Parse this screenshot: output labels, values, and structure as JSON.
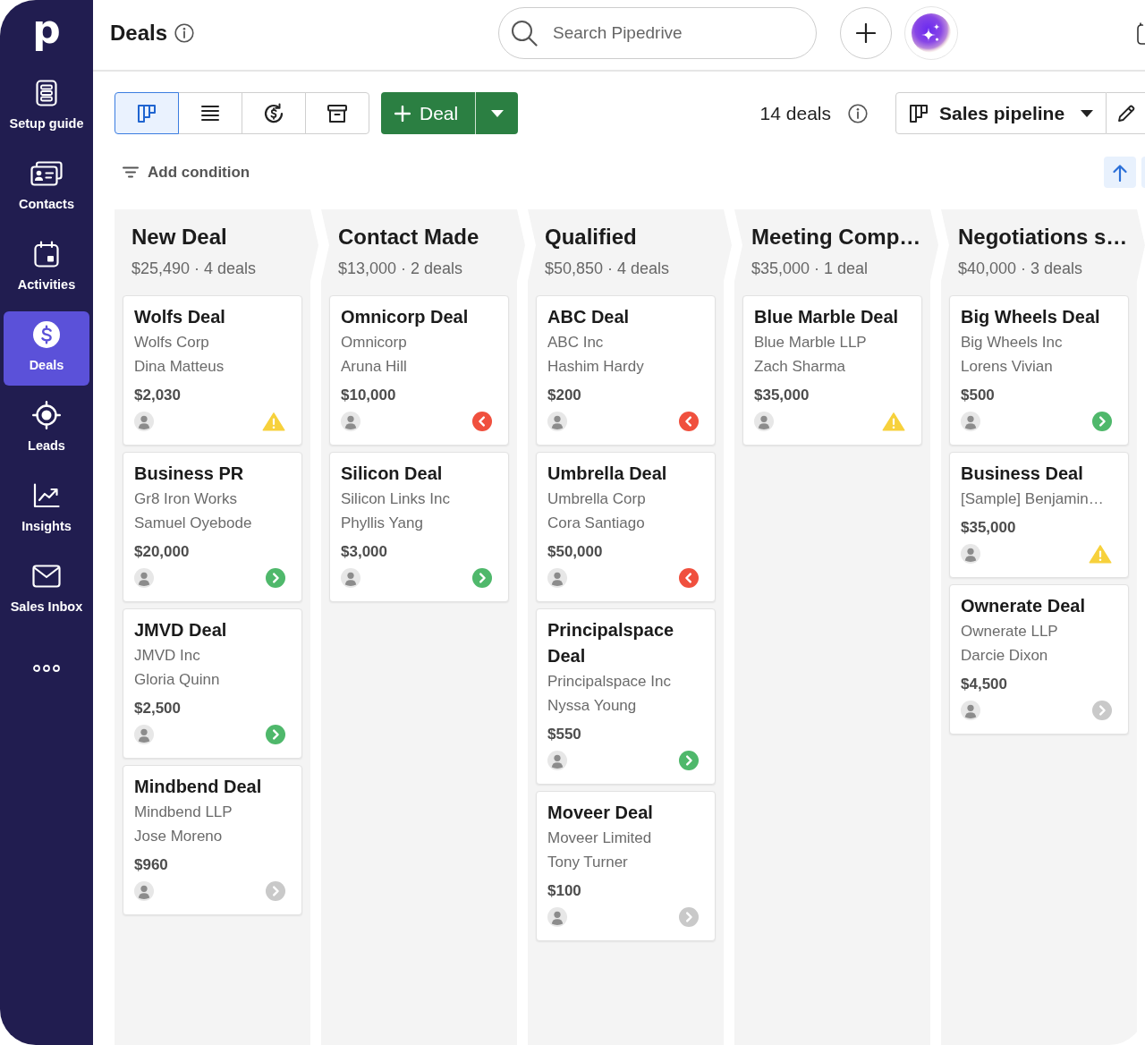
{
  "sidebar": {
    "logo": "p",
    "items": [
      {
        "kind": "guide",
        "label": "Setup guide",
        "selected": false
      },
      {
        "kind": "contacts",
        "label": "Contacts",
        "selected": false
      },
      {
        "kind": "activities",
        "label": "Activities",
        "selected": false
      },
      {
        "kind": "deals",
        "label": "Deals",
        "selected": true
      },
      {
        "kind": "leads",
        "label": "Leads",
        "selected": false
      },
      {
        "kind": "insights",
        "label": "Insights",
        "selected": false
      },
      {
        "kind": "inbox",
        "label": "Sales Inbox",
        "selected": false
      }
    ]
  },
  "header": {
    "title": "Deals",
    "search": {
      "placeholder": "Search Pipedrive"
    }
  },
  "toolbar": {
    "views": [
      {
        "kind": "board",
        "selected": true
      },
      {
        "kind": "list",
        "selected": false
      },
      {
        "kind": "forecast",
        "selected": false
      },
      {
        "kind": "archive",
        "selected": false
      }
    ],
    "add_button": "Deal",
    "deal_count": "14 deals",
    "pipeline": "Sales pipeline",
    "filter": "Add condition"
  },
  "columns": [
    {
      "title": "New Deal",
      "summary": "$25,490 · 4 deals",
      "deals": [
        {
          "kind": "warning",
          "title": "Wolfs Deal",
          "organization": "Wolfs Corp",
          "person": "Dina Matteus",
          "value": "$2,030"
        },
        {
          "kind": "scheduled",
          "title": "Business PR",
          "organization": "Gr8 Iron Works",
          "person": "Samuel Oyebode",
          "value": "$20,000"
        },
        {
          "kind": "scheduled",
          "title": "JMVD Deal",
          "organization": "JMVD Inc",
          "person": "Gloria Quinn",
          "value": "$2,500"
        },
        {
          "kind": "none",
          "title": "Mindbend Deal",
          "organization": "Mindbend LLP",
          "person": "Jose Moreno",
          "value": "$960"
        }
      ]
    },
    {
      "title": "Contact Made",
      "summary": "$13,000 · 2 deals",
      "deals": [
        {
          "kind": "overdue",
          "title": "Omnicorp Deal",
          "organization": "Omnicorp",
          "person": "Aruna Hill",
          "value": "$10,000"
        },
        {
          "kind": "scheduled",
          "title": "Silicon Deal",
          "organization": "Silicon Links Inc",
          "person": "Phyllis Yang",
          "value": "$3,000"
        }
      ]
    },
    {
      "title": "Qualified",
      "summary": "$50,850 · 4 deals",
      "deals": [
        {
          "kind": "overdue",
          "title": "ABC Deal",
          "organization": "ABC Inc",
          "person": "Hashim Hardy",
          "value": "$200"
        },
        {
          "kind": "overdue",
          "title": "Umbrella Deal",
          "organization": "Umbrella Corp",
          "person": "Cora Santiago",
          "value": "$50,000"
        },
        {
          "kind": "scheduled",
          "title": "Principalspace Deal",
          "organization": "Principalspace Inc",
          "person": "Nyssa Young",
          "value": "$550"
        },
        {
          "kind": "none",
          "title": "Moveer Deal",
          "organization": "Moveer Limited",
          "person": "Tony Turner",
          "value": "$100"
        }
      ]
    },
    {
      "title": "Meeting Comp…",
      "summary": "$35,000 · 1 deal",
      "deals": [
        {
          "kind": "warning",
          "title": "Blue Marble Deal",
          "organization": "Blue Marble LLP",
          "person": "Zach Sharma",
          "value": "$35,000"
        }
      ]
    },
    {
      "title": "Negotiations s…",
      "summary": "$40,000 · 3 deals",
      "deals": [
        {
          "kind": "scheduled",
          "title": "Big Wheels Deal",
          "organization": "Big Wheels Inc",
          "person": "Lorens Vivian",
          "value": "$500"
        },
        {
          "kind": "warning",
          "title": "Business Deal",
          "organization": "[Sample] Benjamin…",
          "value": "$35,000"
        },
        {
          "kind": "none",
          "title": "Ownerate Deal",
          "organization": "Ownerate LLP",
          "person": "Darcie Dixon",
          "value": "$4,500"
        }
      ]
    }
  ]
}
